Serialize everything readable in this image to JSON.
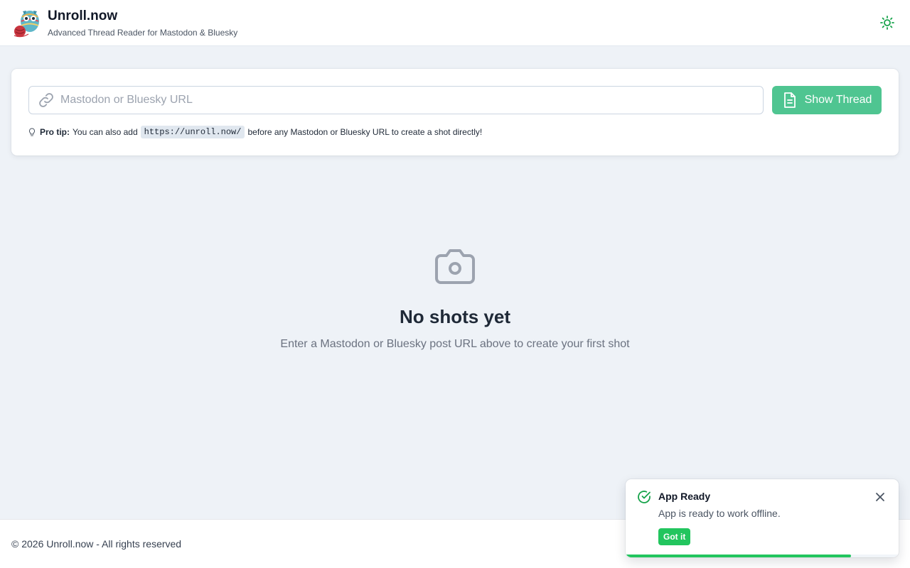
{
  "header": {
    "title": "Unroll.now",
    "subtitle": "Advanced Thread Reader for Mastodon & Bluesky",
    "logo_icon": "mascot-logo-icon",
    "theme_icon": "sun-icon"
  },
  "search": {
    "placeholder": "Mastodon or Bluesky URL",
    "value": "",
    "link_icon": "link-icon",
    "button_label": "Show Thread",
    "button_icon": "document-icon"
  },
  "tip": {
    "label": "Pro tip:",
    "text_before": "You can also add",
    "code": "https://unroll.now/",
    "text_after": "before any Mastodon or Bluesky URL to create a shot directly!",
    "icon": "lightbulb-icon"
  },
  "empty_state": {
    "icon": "camera-icon",
    "title": "No shots yet",
    "message": "Enter a Mastodon or Bluesky post URL above to create your first shot"
  },
  "footer": {
    "text": "© 2026 Unroll.now - All rights reserved"
  },
  "toast": {
    "icon": "check-circle-icon",
    "title": "App Ready",
    "message": "App is ready to work offline.",
    "action_label": "Got it",
    "close_icon": "close-icon",
    "progress": 0.825
  },
  "colors": {
    "accent": "#4fc591",
    "success": "#22c55e",
    "background": "#eef2f7"
  }
}
